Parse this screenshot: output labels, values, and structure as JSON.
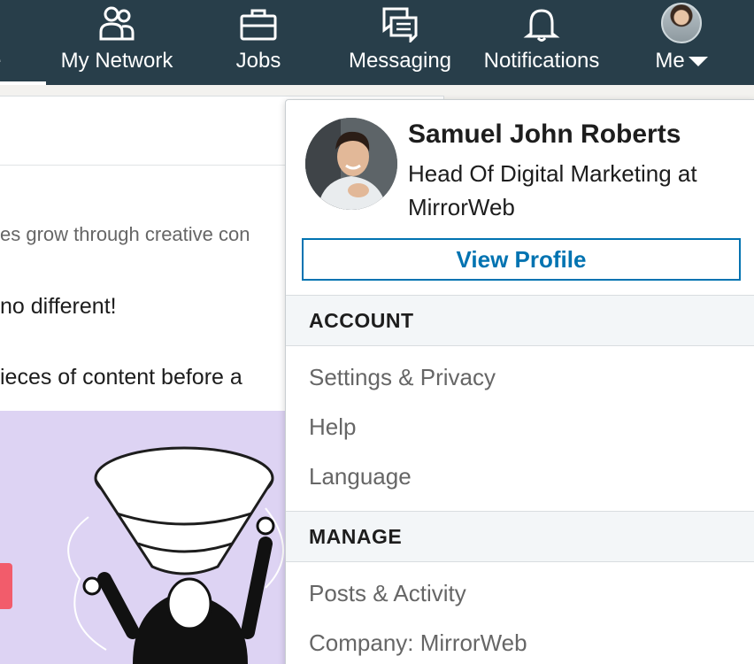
{
  "nav": {
    "home_label": "e",
    "items": [
      {
        "label": "My Network",
        "icon": "network-icon"
      },
      {
        "label": "Jobs",
        "icon": "briefcase-icon"
      },
      {
        "label": "Messaging",
        "icon": "messaging-icon"
      },
      {
        "label": "Notifications",
        "icon": "bell-icon"
      }
    ],
    "me_label": "Me",
    "colors": {
      "bar": "#283e4a",
      "text": "#ffffff"
    }
  },
  "feed": {
    "subtitle": "es grow through creative con",
    "line1": " no different!",
    "line2": "ieces of content before a"
  },
  "dropdown": {
    "name": "Samuel John Roberts",
    "headline": "Head Of Digital Marketing at MirrorWeb",
    "view_profile": "View Profile",
    "account_header": "ACCOUNT",
    "account_items": [
      "Settings & Privacy",
      "Help",
      "Language"
    ],
    "manage_header": "MANAGE",
    "manage_items": [
      "Posts & Activity",
      "Company: MirrorWeb"
    ],
    "accent": "#0073b1"
  }
}
